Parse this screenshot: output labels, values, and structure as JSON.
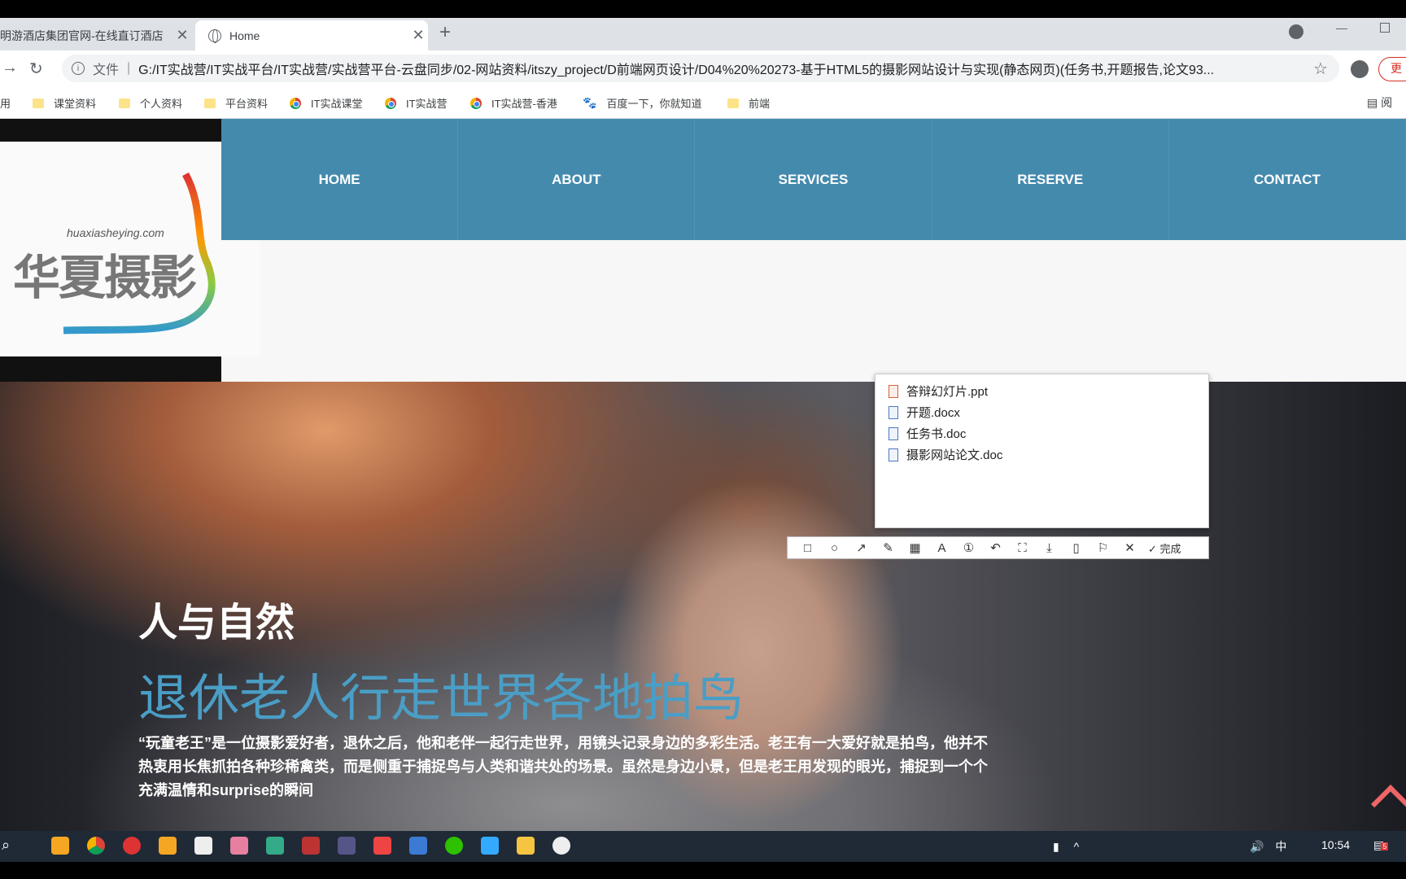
{
  "browser": {
    "tabs": [
      {
        "title": "明游酒店集团官网-在线直订酒店",
        "active": false
      },
      {
        "title": "Home",
        "active": true
      }
    ],
    "url_scheme": "文件",
    "url": "G:/IT实战营/IT实战平台/IT实战营/实战营平台-云盘同步/02-网站资料/itszy_project/D前端网页设计/D04%20%20273-基于HTML5的摄影网站设计与实现(静态网页)(任务书,开题报告,论文93...",
    "update_label": "更",
    "apps_label": "应用",
    "bookmarks": [
      {
        "label": "课堂资料",
        "icon": "folder-icon"
      },
      {
        "label": "个人资料",
        "icon": "folder-icon"
      },
      {
        "label": "平台资料",
        "icon": "folder-icon"
      },
      {
        "label": "IT实战课堂",
        "icon": "chrome-icon"
      },
      {
        "label": "IT实战营",
        "icon": "chrome-icon"
      },
      {
        "label": "IT实战营-香港",
        "icon": "chrome-icon"
      },
      {
        "label": "百度一下，你就知道",
        "icon": "paw-icon"
      },
      {
        "label": "前端",
        "icon": "folder-icon"
      }
    ],
    "reading_label": "阅"
  },
  "site": {
    "logo": {
      "text": "华夏摄影",
      "url": "huaxiasheying.com"
    },
    "nav": [
      "HOME",
      "ABOUT",
      "SERVICES",
      "RESERVE",
      "CONTACT"
    ],
    "hero": {
      "title": "人与自然",
      "subtitle": "退休老人行走世界各地拍鸟",
      "paragraph": "“玩童老王”是一位摄影爱好者，退休之后，他和老伴一起行走世界，用镜头记录身边的多彩生活。老王有一大爱好就是拍鸟，他并不热衷用长焦抓拍各种珍稀禽类，而是侧重于捕捉鸟与人类和谐共处的场景。虽然是身边小景，但是老王用发现的眼光，捕捉到一个个充满温情和surprise的瞬间"
    }
  },
  "file_popup": {
    "files": [
      {
        "name": "答辩幻灯片.ppt",
        "type": "ppt"
      },
      {
        "name": "开题.docx",
        "type": "doc"
      },
      {
        "name": "任务书.doc",
        "type": "doc"
      },
      {
        "name": "摄影网站论文.doc",
        "type": "doc"
      }
    ]
  },
  "snip_toolbar": {
    "done_label": "完成"
  },
  "taskbar": {
    "time": "10:54",
    "ime": "中",
    "notification_count": "5"
  },
  "colors": {
    "nav_bg": "#448aad",
    "hero_subtitle": "#4a9ec6"
  }
}
